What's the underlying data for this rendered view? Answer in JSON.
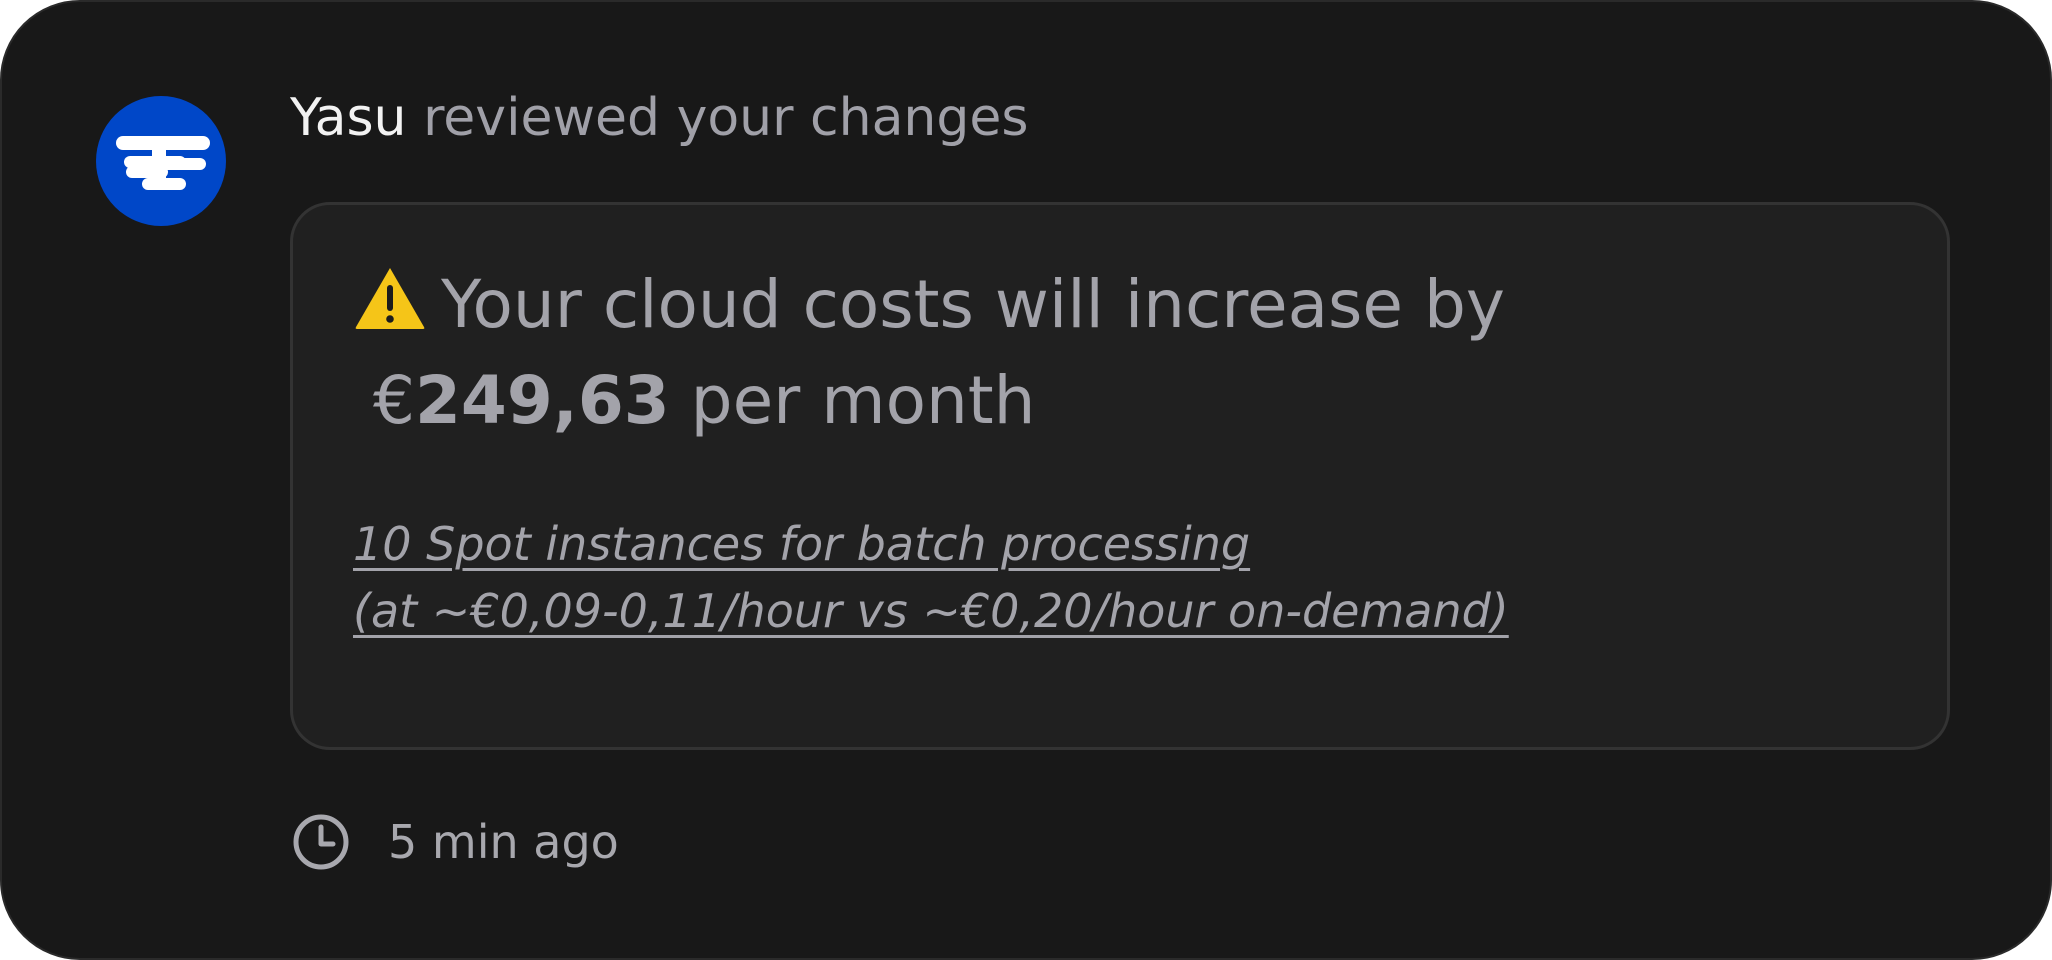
{
  "notification": {
    "author": "Yasu",
    "action": "reviewed your changes",
    "avatar_icon": "yasu-logo-icon",
    "colors": {
      "avatar_background": "#0047c8",
      "warning": "#f5c518"
    }
  },
  "cost_alert": {
    "icon": "warning-icon",
    "headline_prefix": "Your cloud costs will increase by",
    "currency": "€",
    "amount": "249,63",
    "period": "per month",
    "detail_line_1": "10 Spot instances for batch processing",
    "detail_line_2": "(at ~€0,09-0,11/hour vs ~€0,20/hour on-demand)"
  },
  "footer": {
    "icon": "clock-icon",
    "timestamp": "5 min ago"
  }
}
